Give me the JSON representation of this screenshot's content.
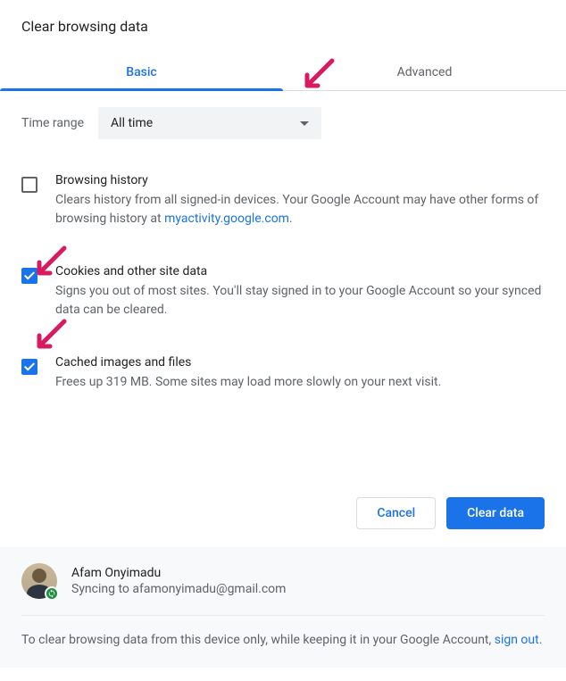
{
  "title": "Clear browsing data",
  "tabs": {
    "basic": "Basic",
    "advanced": "Advanced"
  },
  "time": {
    "label": "Time range",
    "value": "All time"
  },
  "opts": [
    {
      "title": "Browsing history",
      "desc_pre": "Clears history from all signed-in devices. Your Google Account may have other forms of browsing history at ",
      "link": "myactivity.google.com",
      "desc_post": ".",
      "checked": false
    },
    {
      "title": "Cookies and other site data",
      "desc": "Signs you out of most sites. You'll stay signed in to your Google Account so your synced data can be cleared.",
      "checked": true
    },
    {
      "title": "Cached images and files",
      "desc": "Frees up 319 MB. Some sites may load more slowly on your next visit.",
      "checked": true
    }
  ],
  "buttons": {
    "cancel": "Cancel",
    "confirm": "Clear data"
  },
  "user": {
    "name": "Afam Onyimadu",
    "sync_pre": "Syncing to ",
    "email": "afamonyimadu@gmail.com"
  },
  "footnote": {
    "pre": "To clear browsing data from this device only, while keeping it in your Google Account, ",
    "link": "sign out",
    "post": "."
  },
  "annotation_color": "#d81b60"
}
